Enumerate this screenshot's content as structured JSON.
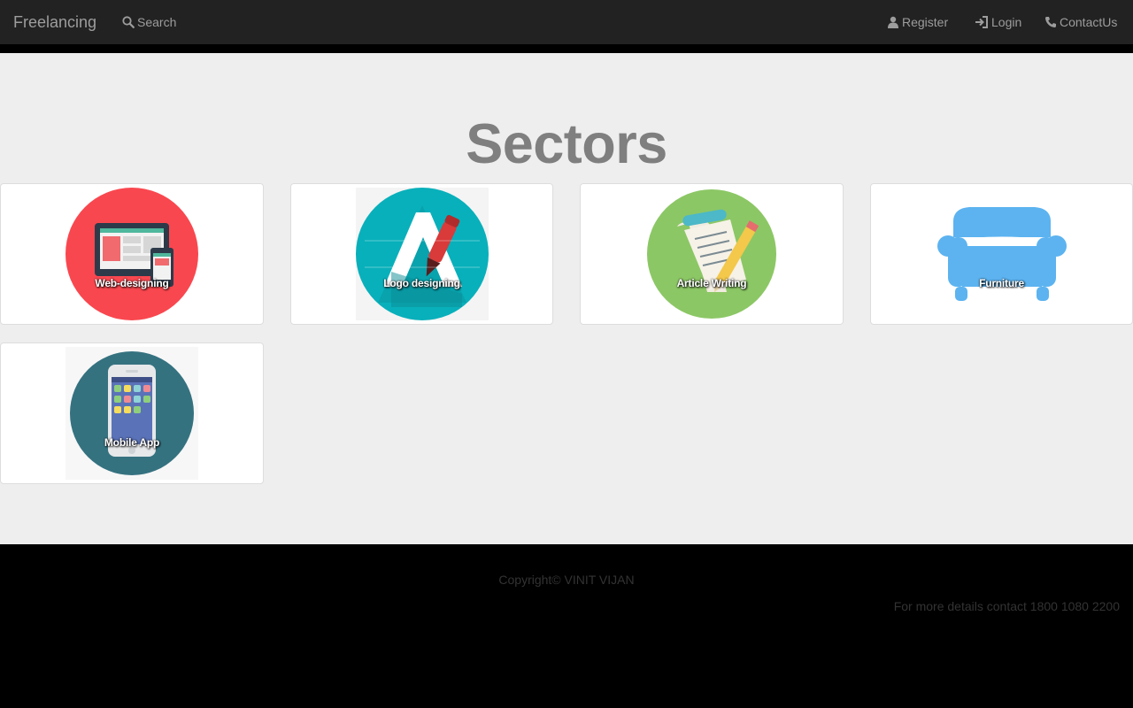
{
  "navbar": {
    "brand": "Freelancing",
    "search": "Search",
    "register": "Register",
    "login": "Login",
    "contact": "ContactUs",
    "background": "#222222",
    "link_color": "#9d9d9d"
  },
  "main": {
    "heading": "Sectors",
    "background": "#eeeeee",
    "sectors": [
      {
        "label": "Web-designing",
        "icon": "web-design-icon",
        "color": "#f9474f"
      },
      {
        "label": "Logo designing",
        "icon": "logo-design-icon",
        "color": "#08b0bb"
      },
      {
        "label": "Article Writing",
        "icon": "article-writing-icon",
        "color": "#8cc765"
      },
      {
        "label": "Furniture",
        "icon": "sofa-icon",
        "color": "#5cb3f0"
      },
      {
        "label": "Mobile App",
        "icon": "mobile-app-icon",
        "color": "#357280"
      }
    ]
  },
  "footer": {
    "copyright": "Copyright© VINIT VIJAN",
    "contact": "For more details contact 1800 1080 2200",
    "background": "#000000"
  }
}
